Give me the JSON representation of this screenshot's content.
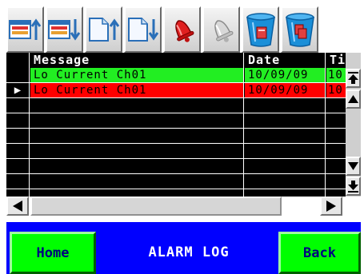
{
  "toolbar": {
    "buttons": [
      {
        "name": "move-log-up-icon",
        "color": "#e03030"
      },
      {
        "name": "move-log-down-icon",
        "color": "#e03030"
      },
      {
        "name": "page-up-icon",
        "color": "#3da3e8"
      },
      {
        "name": "page-down-icon",
        "color": "#3da3e8"
      },
      {
        "name": "acknowledge-alarm-bell-icon",
        "color": "#e02020"
      },
      {
        "name": "silenced-bell-icon",
        "color": "#a0a0a0"
      },
      {
        "name": "delete-alarm-trash-icon",
        "color": "#1a8fd8"
      },
      {
        "name": "delete-all-trash-icon",
        "color": "#1a8fd8"
      }
    ]
  },
  "table": {
    "headers": {
      "message": "Message",
      "date": "Date",
      "time": "Ti"
    },
    "rows": [
      {
        "message": "Lo Current Ch01",
        "date": "10/09/09",
        "time": "10",
        "bg": "#22ee22",
        "fg": "#000000",
        "selected": false
      },
      {
        "message": "Lo Current Ch01",
        "date": "10/09/09",
        "time": "10",
        "bg": "#ff0000",
        "fg": "#000000",
        "selected": true
      },
      {
        "message": "",
        "date": "",
        "time": "",
        "bg": "#000000",
        "fg": "#ffffff",
        "selected": false
      },
      {
        "message": "",
        "date": "",
        "time": "",
        "bg": "#000000",
        "fg": "#ffffff",
        "selected": false
      },
      {
        "message": "",
        "date": "",
        "time": "",
        "bg": "#000000",
        "fg": "#ffffff",
        "selected": false
      },
      {
        "message": "",
        "date": "",
        "time": "",
        "bg": "#000000",
        "fg": "#ffffff",
        "selected": false
      },
      {
        "message": "",
        "date": "",
        "time": "",
        "bg": "#000000",
        "fg": "#ffffff",
        "selected": false
      },
      {
        "message": "",
        "date": "",
        "time": "",
        "bg": "#000000",
        "fg": "#ffffff",
        "selected": false
      }
    ],
    "selection_marker": "▶"
  },
  "footer": {
    "home_label": "Home",
    "title": "ALARM LOG",
    "back_label": "Back"
  }
}
